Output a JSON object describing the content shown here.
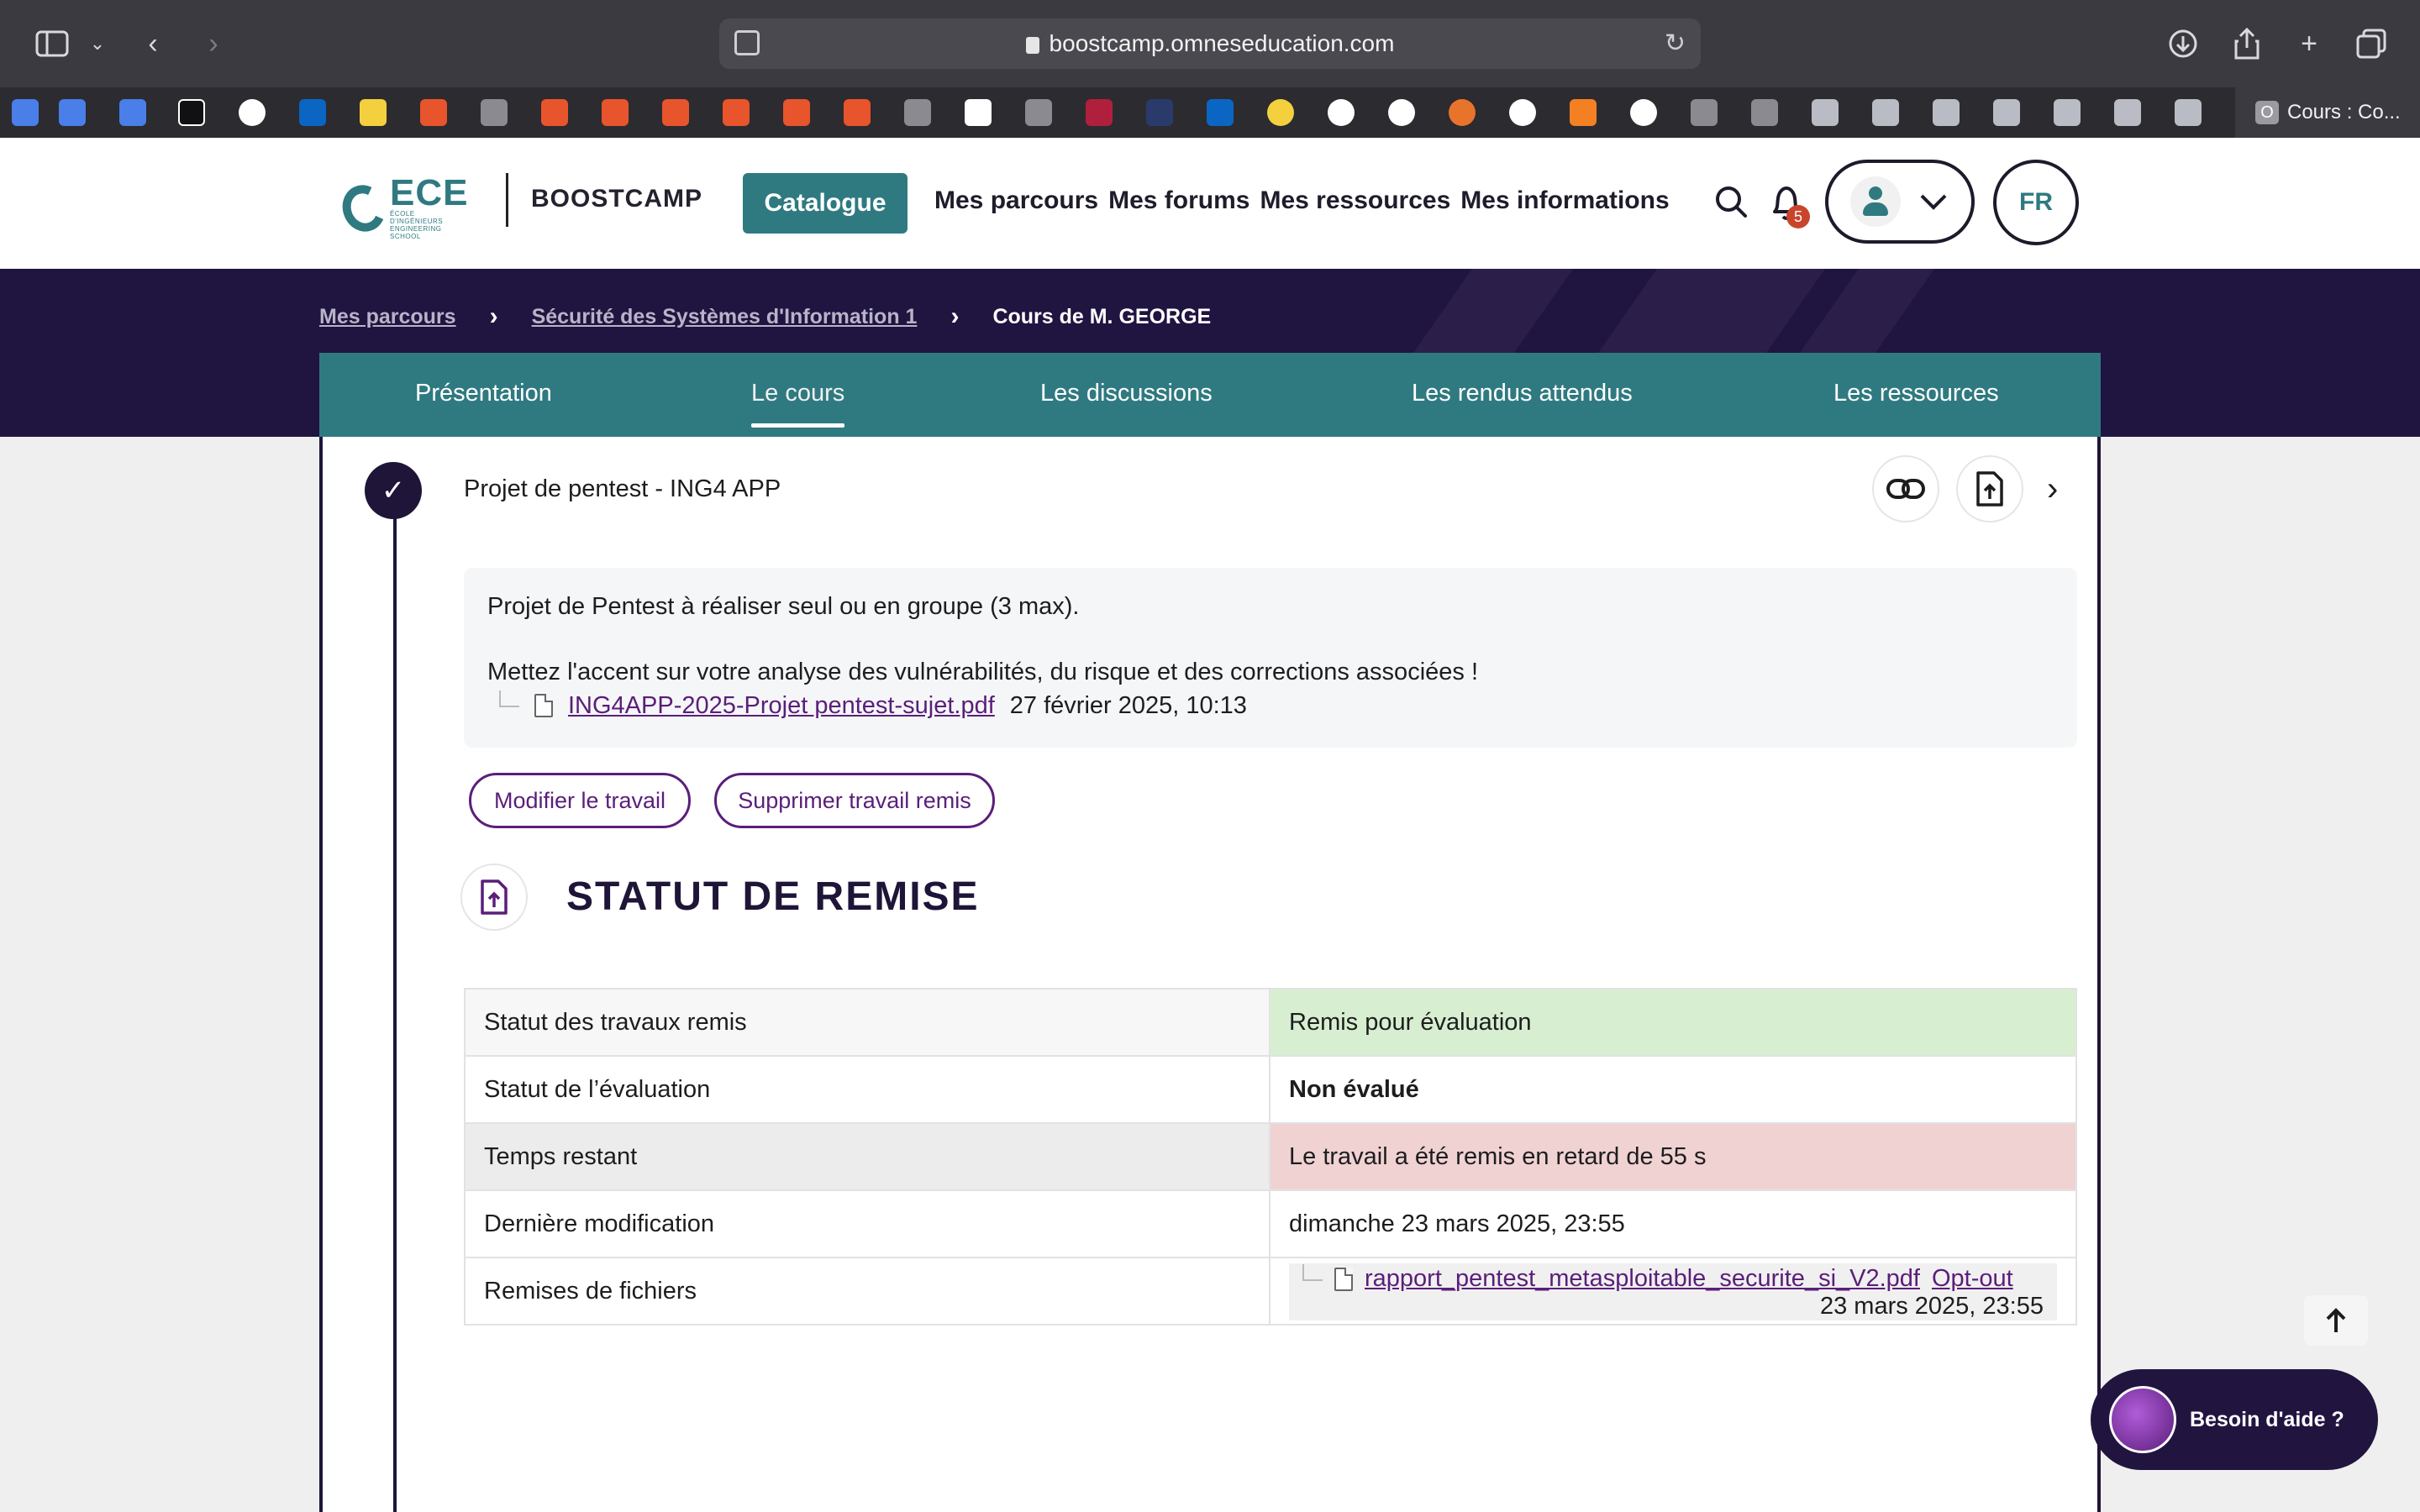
{
  "browser": {
    "url": "boostcamp.omneseducation.com",
    "active_tab_title": "Cours : Co...",
    "active_tab_icon_letter": "O"
  },
  "header": {
    "logo_text": "ECE",
    "logo_subtitle": "ÉCOLE D'INGÉNIEURS ENGINEERING SCHOOL",
    "brand": "BOOSTCAMP",
    "catalogue_label": "Catalogue",
    "nav": [
      "Mes parcours",
      "Mes forums",
      "Mes ressources",
      "Mes informations"
    ],
    "notification_count": "5",
    "lang": "FR"
  },
  "breadcrumb": {
    "items": [
      "Mes parcours",
      "Sécurité des Systèmes d'Information 1",
      "Cours de M. GEORGE"
    ]
  },
  "tabs": [
    "Présentation",
    "Le cours",
    "Les discussions",
    "Les rendus attendus",
    "Les ressources"
  ],
  "activity": {
    "title": "Projet de pentest - ING4 APP",
    "description_1": "Projet de Pentest à réaliser seul ou en groupe (3 max).",
    "description_2": "Mettez l'accent sur votre analyse des vulnérabilités, du risque et des corrections associées !",
    "file_name": "ING4APP-2025-Projet pentest-sujet.pdf",
    "file_date": "27 février 2025, 10:13",
    "btn_edit": "Modifier le travail",
    "btn_delete": "Supprimer travail remis"
  },
  "submission": {
    "heading": "STATUT DE REMISE",
    "rows": [
      {
        "label": "Statut des travaux remis",
        "value": "Remis pour évaluation"
      },
      {
        "label": "Statut de l’évaluation",
        "value": "Non évalué"
      },
      {
        "label": "Temps restant",
        "value": "Le travail a été remis en retard de 55 s"
      },
      {
        "label": "Dernière modification",
        "value": "dimanche 23 mars 2025, 23:55"
      },
      {
        "label": "Remises de fichiers",
        "value": ""
      }
    ],
    "file_name": "rapport_pentest_metasploitable_securite_si_V2.pdf",
    "opt_out": "Opt-out",
    "file_date": "23 mars 2025, 23:55"
  },
  "help_label": "Besoin d'aide ?",
  "colors": {
    "teal": "#2f7a80",
    "navy": "#201440",
    "purple_link": "#5a1e7a",
    "status_green": "#d7efd0",
    "status_red": "#f0d2d2"
  }
}
